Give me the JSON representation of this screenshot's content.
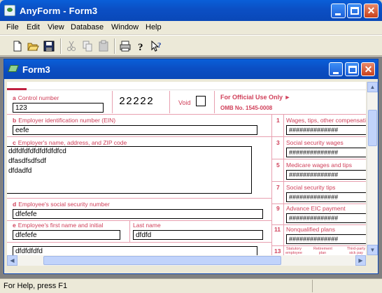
{
  "app": {
    "title": "AnyForm - Form3"
  },
  "menu": [
    "File",
    "Edit",
    "View",
    "Database",
    "Window",
    "Help"
  ],
  "toolbar": [
    "new-icon",
    "open-icon",
    "save-icon",
    "cut-icon",
    "copy-icon",
    "paste-icon",
    "print-icon",
    "help-icon",
    "context-help-icon"
  ],
  "child": {
    "title": "Form3"
  },
  "form": {
    "control_label": "Control number",
    "control_letter": "a",
    "control_value": "123",
    "form_code": "22222",
    "void_label": "Void",
    "official_use": "For Official Use Only ►",
    "omb": "OMB No. 1545-0008",
    "ein_letter": "b",
    "ein_label": "Employer identification number (EIN)",
    "ein_value": "eefe",
    "employer_letter": "c",
    "employer_label": "Employer's name, address, and ZIP code",
    "employer_lines": [
      "ddfdfdfdfdfdfdfdfcd",
      "dfasdfsdfsdf",
      "dfdadfd"
    ],
    "ssn_letter": "d",
    "ssn_label": "Employee's social security number",
    "ssn_value": "dfefefe",
    "first_letter": "e",
    "first_label": "Employee's first name and initial",
    "first_value": "dfefefe",
    "last_label": "Last name",
    "last_value": "dfdfd",
    "address_value": "dfdfdfdfd",
    "box1_num": "1",
    "box1_label": "Wages, tips, other compensation",
    "box1_value": "##############",
    "box3_num": "3",
    "box3_label": "Social security wages",
    "box3_value": "##############",
    "box5_num": "5",
    "box5_label": "Medicare wages and tips",
    "box5_value": "##############",
    "box7_num": "7",
    "box7_label": "Social security tips",
    "box7_value": "##############",
    "box9_num": "9",
    "box9_label": "Advance EIC payment",
    "box9_value": "##############",
    "box11_num": "11",
    "box11_label": "Nonqualified plans",
    "box11_value": "##############",
    "box13_num": "13",
    "box13_statutory": "Statutory employee",
    "box13_retirement": "Retirement plan",
    "box13_thirdparty": "Third-party sick pay"
  },
  "status": {
    "text": "For Help, press F1"
  }
}
